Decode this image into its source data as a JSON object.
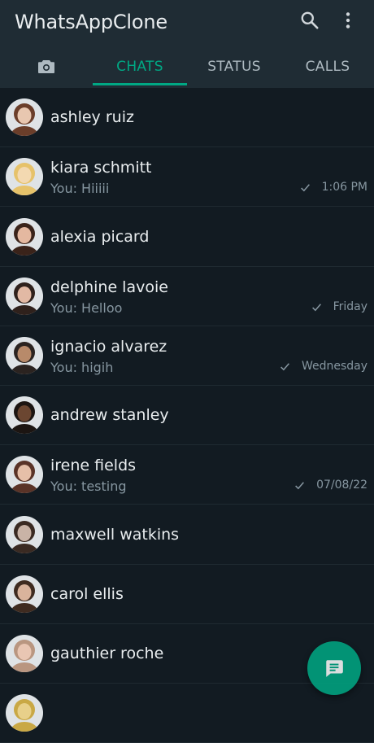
{
  "header": {
    "title": "WhatsAppClone",
    "icons": [
      "search-icon",
      "more-vert-icon"
    ]
  },
  "tabs": [
    {
      "name": "camera",
      "label": "",
      "icon": "camera-icon"
    },
    {
      "name": "chats",
      "label": "CHATS",
      "active": true
    },
    {
      "name": "status",
      "label": "STATUS"
    },
    {
      "name": "calls",
      "label": "CALLS"
    }
  ],
  "colors": {
    "accent": "#00a884",
    "appbar": "#1f2c34",
    "background": "#121b22",
    "secondary_text": "#8696a0"
  },
  "chats": [
    {
      "name": "ashley ruiz",
      "preview": "",
      "time": ""
    },
    {
      "name": "kiara schmitt",
      "preview": "You: Hiiiii",
      "time": "1:06 PM"
    },
    {
      "name": "alexia picard",
      "preview": "",
      "time": ""
    },
    {
      "name": "delphine lavoie",
      "preview": "You: Helloo",
      "time": "Friday"
    },
    {
      "name": "ignacio alvarez",
      "preview": "You: higih",
      "time": "Wednesday"
    },
    {
      "name": "andrew stanley",
      "preview": "",
      "time": ""
    },
    {
      "name": "irene fields",
      "preview": "You: testing",
      "time": "07/08/22"
    },
    {
      "name": "maxwell watkins",
      "preview": "",
      "time": ""
    },
    {
      "name": "carol ellis",
      "preview": "",
      "time": ""
    },
    {
      "name": "gauthier roche",
      "preview": "",
      "time": ""
    },
    {
      "name": "",
      "preview": "",
      "time": ""
    }
  ],
  "fab": {
    "icon": "new-chat-icon"
  }
}
